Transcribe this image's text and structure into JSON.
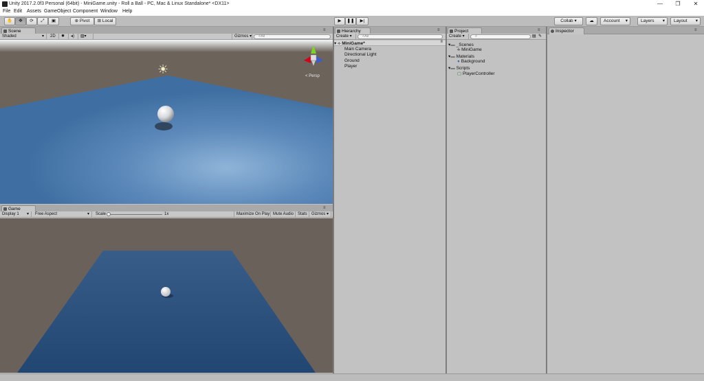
{
  "window": {
    "title": "Unity 2017.2.0f3 Personal (64bit) - MiniGame.unity - Roll a Ball - PC, Mac & Linux Standalone* <DX11>",
    "minimize": "—",
    "restore": "❐",
    "close": "✕"
  },
  "menu": [
    "File",
    "Edit",
    "Assets",
    "GameObject",
    "Component",
    "Window",
    "Help"
  ],
  "toolbar": {
    "pivot": "Pivot",
    "local": "Local",
    "collab": "Collab ▾",
    "account": "Account",
    "layers": "Layers",
    "layout": "Layout"
  },
  "scene": {
    "tab": "Scene",
    "shading": "Shaded",
    "mode2d": "2D",
    "gizmos": "Gizmos ▾",
    "search_placeholder": "All",
    "persp": "< Persp"
  },
  "game": {
    "tab": "Game",
    "display": "Display 1",
    "aspect": "Free Aspect",
    "scale_label": "Scale",
    "scale_value": "1x",
    "maximize": "Maximize On Play",
    "mute": "Mute Audio",
    "stats": "Stats",
    "gizmos": "Gizmos ▾"
  },
  "hierarchy": {
    "tab": "Hierarchy",
    "create": "Create ▾",
    "search_placeholder": "All",
    "root": "MiniGame*",
    "items": [
      "Main Camera",
      "Directional Light",
      "Ground",
      "Player"
    ]
  },
  "project": {
    "tab": "Project",
    "create": "Create ▾",
    "folders": [
      {
        "name": "_Scenes",
        "children": [
          "MiniGame"
        ]
      },
      {
        "name": "Materials",
        "children": [
          "Background"
        ]
      },
      {
        "name": "Scripts",
        "children": [
          "PlayerController"
        ]
      }
    ]
  },
  "inspector": {
    "tab": "Inspector"
  },
  "colors": {
    "ground_scene": "#4d7aa8",
    "ground_game": "#2f5581",
    "game_bg": "#6a615a",
    "scene_bg": "#6c635b"
  }
}
